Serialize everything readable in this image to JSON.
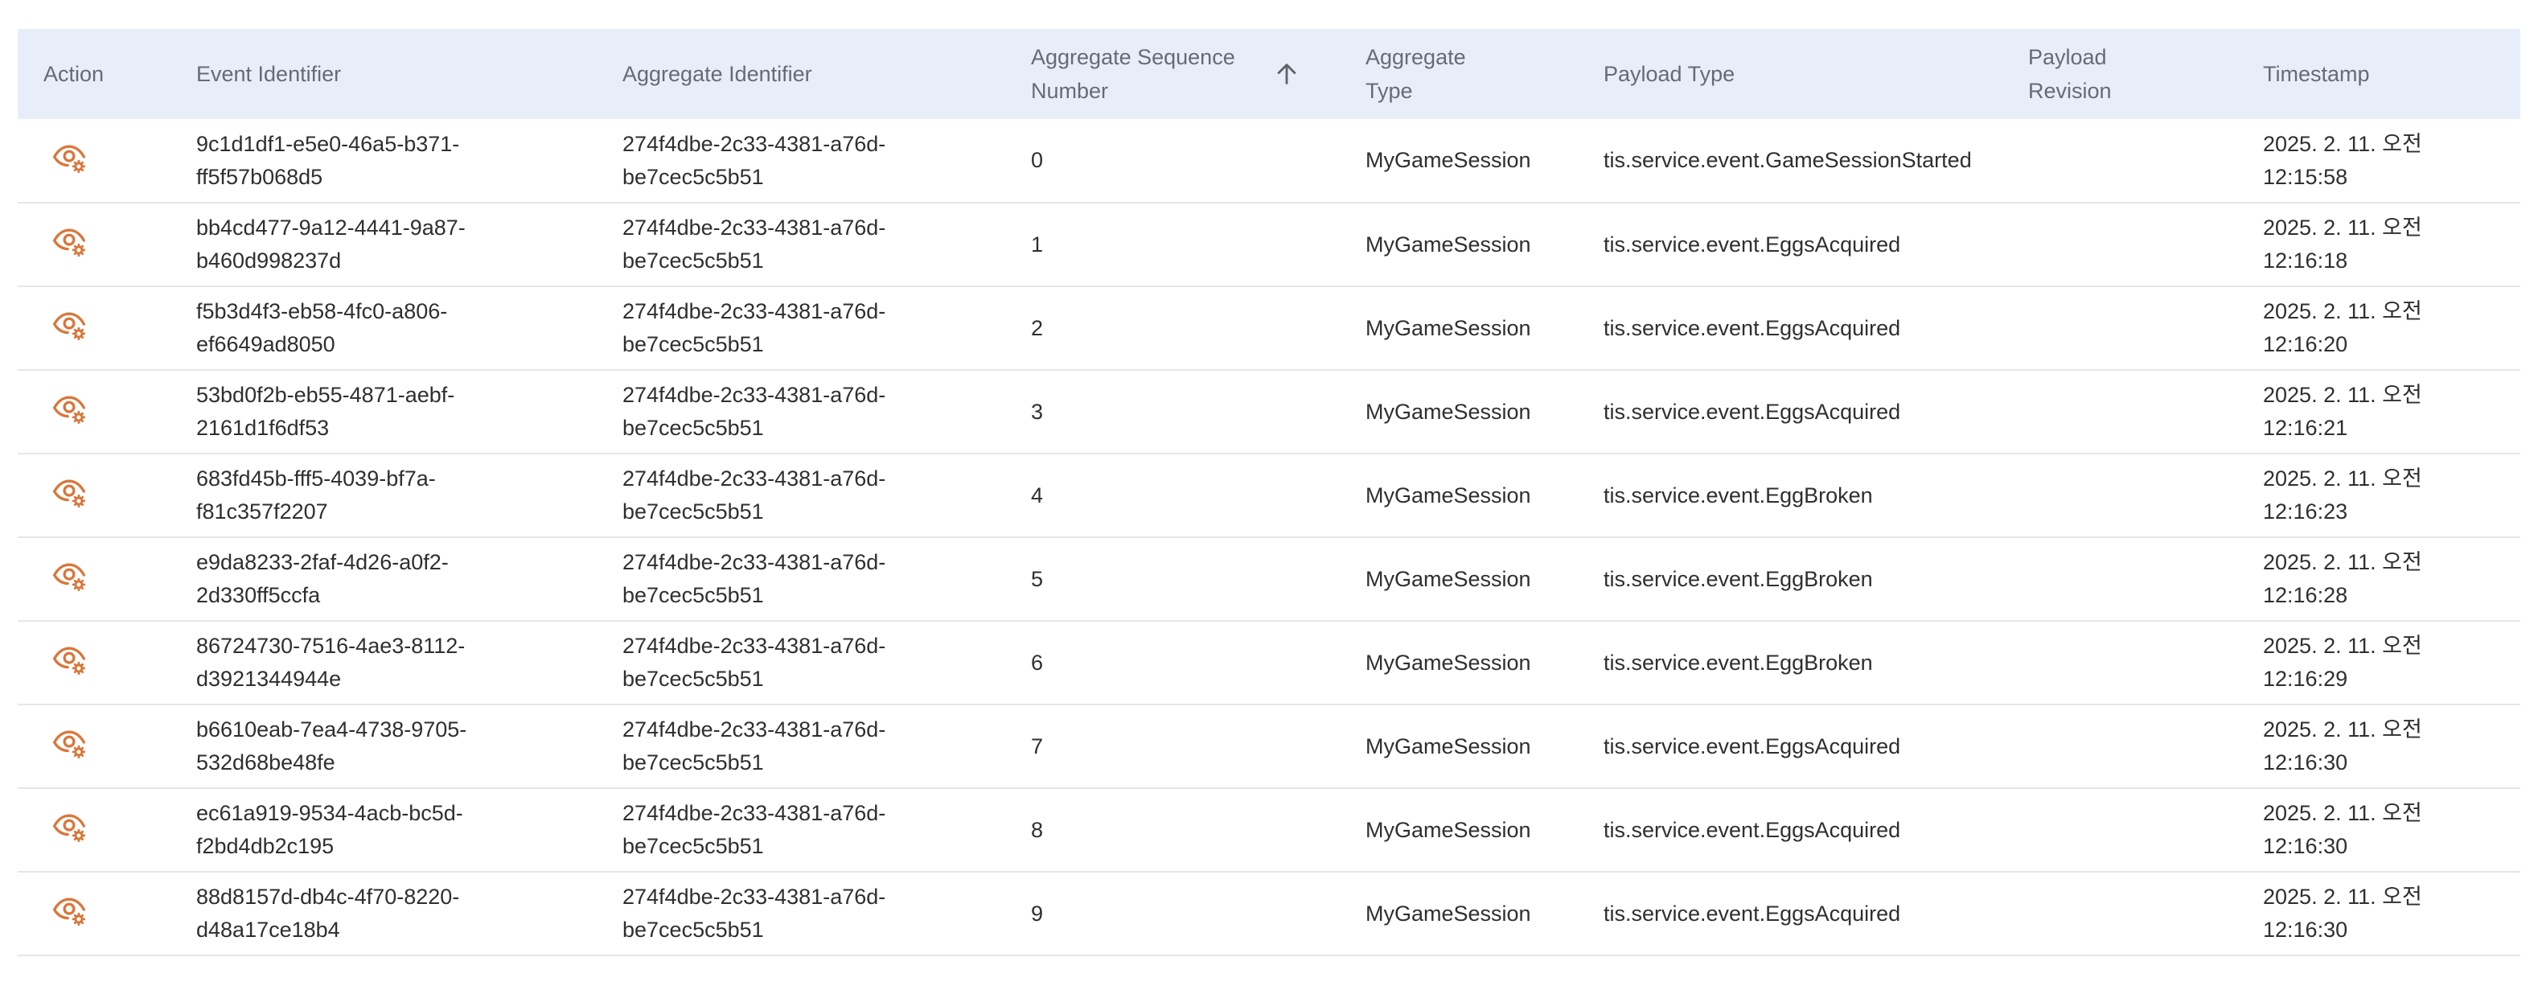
{
  "table": {
    "columns": [
      "Action",
      "Event Identifier",
      "Aggregate Identifier",
      "Aggregate Sequence Number",
      "Aggregate Type",
      "Payload Type",
      "Payload Revision",
      "Timestamp"
    ],
    "sort": {
      "column": "Aggregate Sequence Number",
      "direction": "ascending",
      "icon": "arrow-up-icon"
    },
    "action_icon": "view-details-icon",
    "colors": {
      "header_bg": "#e8eef9",
      "icon": "#d9773a",
      "row_divider": "#e6e6e6"
    },
    "rows": [
      {
        "event_id_1": "9c1d1df1-e5e0-46a5-b371-",
        "event_id_2": "ff5f57b068d5",
        "agg_id_1": "274f4dbe-2c33-4381-a76d-",
        "agg_id_2": "be7cec5c5b51",
        "seq": "0",
        "type": "MyGameSession",
        "payload": "tis.service.event.GameSessionStarted",
        "revision": "",
        "ts_1": "2025. 2. 11. 오전",
        "ts_2": "12:15:58"
      },
      {
        "event_id_1": "bb4cd477-9a12-4441-9a87-",
        "event_id_2": "b460d998237d",
        "agg_id_1": "274f4dbe-2c33-4381-a76d-",
        "agg_id_2": "be7cec5c5b51",
        "seq": "1",
        "type": "MyGameSession",
        "payload": "tis.service.event.EggsAcquired",
        "revision": "",
        "ts_1": "2025. 2. 11. 오전",
        "ts_2": "12:16:18"
      },
      {
        "event_id_1": "f5b3d4f3-eb58-4fc0-a806-",
        "event_id_2": "ef6649ad8050",
        "agg_id_1": "274f4dbe-2c33-4381-a76d-",
        "agg_id_2": "be7cec5c5b51",
        "seq": "2",
        "type": "MyGameSession",
        "payload": "tis.service.event.EggsAcquired",
        "revision": "",
        "ts_1": "2025. 2. 11. 오전",
        "ts_2": "12:16:20"
      },
      {
        "event_id_1": "53bd0f2b-eb55-4871-aebf-",
        "event_id_2": "2161d1f6df53",
        "agg_id_1": "274f4dbe-2c33-4381-a76d-",
        "agg_id_2": "be7cec5c5b51",
        "seq": "3",
        "type": "MyGameSession",
        "payload": "tis.service.event.EggsAcquired",
        "revision": "",
        "ts_1": "2025. 2. 11. 오전",
        "ts_2": "12:16:21"
      },
      {
        "event_id_1": "683fd45b-fff5-4039-bf7a-",
        "event_id_2": "f81c357f2207",
        "agg_id_1": "274f4dbe-2c33-4381-a76d-",
        "agg_id_2": "be7cec5c5b51",
        "seq": "4",
        "type": "MyGameSession",
        "payload": "tis.service.event.EggBroken",
        "revision": "",
        "ts_1": "2025. 2. 11. 오전",
        "ts_2": "12:16:23"
      },
      {
        "event_id_1": "e9da8233-2faf-4d26-a0f2-",
        "event_id_2": "2d330ff5ccfa",
        "agg_id_1": "274f4dbe-2c33-4381-a76d-",
        "agg_id_2": "be7cec5c5b51",
        "seq": "5",
        "type": "MyGameSession",
        "payload": "tis.service.event.EggBroken",
        "revision": "",
        "ts_1": "2025. 2. 11. 오전",
        "ts_2": "12:16:28"
      },
      {
        "event_id_1": "86724730-7516-4ae3-8112-",
        "event_id_2": "d3921344944e",
        "agg_id_1": "274f4dbe-2c33-4381-a76d-",
        "agg_id_2": "be7cec5c5b51",
        "seq": "6",
        "type": "MyGameSession",
        "payload": "tis.service.event.EggBroken",
        "revision": "",
        "ts_1": "2025. 2. 11. 오전",
        "ts_2": "12:16:29"
      },
      {
        "event_id_1": "b6610eab-7ea4-4738-9705-",
        "event_id_2": "532d68be48fe",
        "agg_id_1": "274f4dbe-2c33-4381-a76d-",
        "agg_id_2": "be7cec5c5b51",
        "seq": "7",
        "type": "MyGameSession",
        "payload": "tis.service.event.EggsAcquired",
        "revision": "",
        "ts_1": "2025. 2. 11. 오전",
        "ts_2": "12:16:30"
      },
      {
        "event_id_1": "ec61a919-9534-4acb-bc5d-",
        "event_id_2": "f2bd4db2c195",
        "agg_id_1": "274f4dbe-2c33-4381-a76d-",
        "agg_id_2": "be7cec5c5b51",
        "seq": "8",
        "type": "MyGameSession",
        "payload": "tis.service.event.EggsAcquired",
        "revision": "",
        "ts_1": "2025. 2. 11. 오전",
        "ts_2": "12:16:30"
      },
      {
        "event_id_1": "88d8157d-db4c-4f70-8220-",
        "event_id_2": "d48a17ce18b4",
        "agg_id_1": "274f4dbe-2c33-4381-a76d-",
        "agg_id_2": "be7cec5c5b51",
        "seq": "9",
        "type": "MyGameSession",
        "payload": "tis.service.event.EggsAcquired",
        "revision": "",
        "ts_1": "2025. 2. 11. 오전",
        "ts_2": "12:16:30"
      }
    ]
  }
}
